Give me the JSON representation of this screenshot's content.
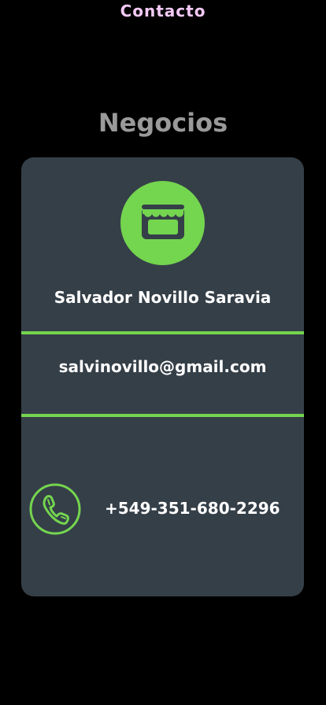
{
  "header": {
    "title": "Contacto"
  },
  "section": {
    "title": "Negocios"
  },
  "contact_card": {
    "icon": "store-icon",
    "name": "Salvador Novillo Saravia",
    "email": "salvinovillo@gmail.com",
    "phone_icon": "phone-icon",
    "phone": "+549-351-680-2296"
  },
  "colors": {
    "background": "#000000",
    "card": "#353f48",
    "accent_green": "#74d54f",
    "header_pink": "#f3c9f6",
    "section_gray": "#9a9a9a",
    "text_white": "#ffffff"
  }
}
